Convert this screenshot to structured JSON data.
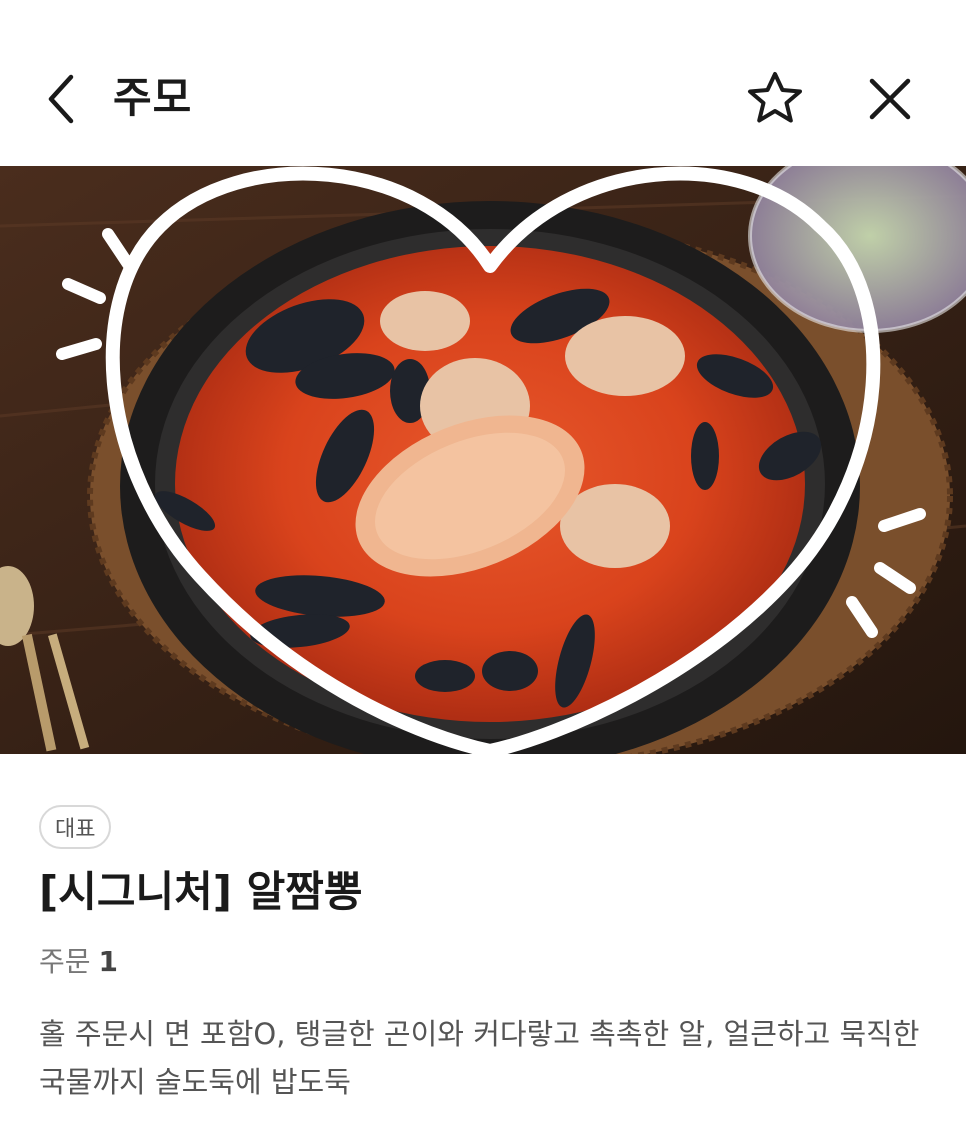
{
  "header": {
    "title": "주모",
    "back_icon": "chevron-left-icon",
    "favorite_icon": "star-outline-icon",
    "close_icon": "close-icon"
  },
  "hero": {
    "image": "signature-al-jjamppong-photo"
  },
  "menu": {
    "badge": "대표",
    "name": "[시그니처] 알짬뽕",
    "order_label": "주문",
    "order_count": "1",
    "description": "홀 주문시 면 포함O, 탱글한 곤이와 커다랗고 촉촉한 알, 얼큰하고 묵직한 국물까지 술도둑에 밥도둑"
  }
}
